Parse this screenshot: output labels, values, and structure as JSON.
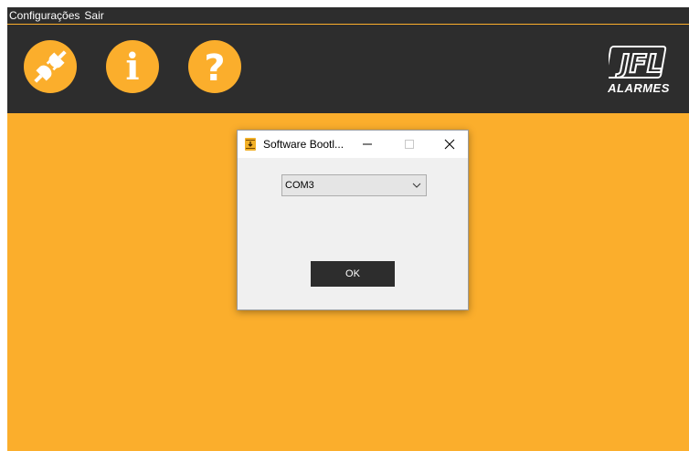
{
  "menu": {
    "items": [
      {
        "label": "Configurações"
      },
      {
        "label": "Sair"
      }
    ]
  },
  "toolbar": {
    "buttons": [
      {
        "icon": "plug-connect-icon"
      },
      {
        "icon": "info-icon"
      },
      {
        "icon": "help-icon"
      }
    ],
    "info_glyph": "i",
    "help_glyph": "?"
  },
  "logo": {
    "mark": "JFL",
    "text": "ALARMES"
  },
  "dialog": {
    "title": "Software Bootl...",
    "port_select": {
      "value": "COM3"
    },
    "ok_label": "OK"
  },
  "colors": {
    "accent": "#fbae2c",
    "dark": "#2d2d2d"
  }
}
